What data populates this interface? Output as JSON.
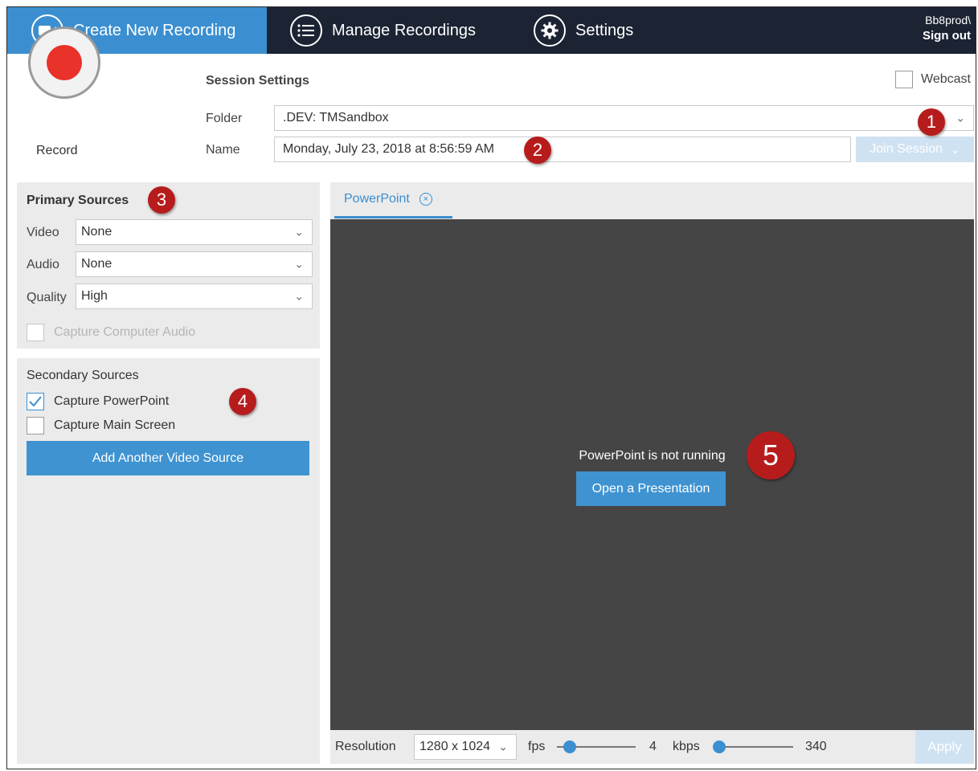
{
  "nav": {
    "tabs": [
      {
        "label": "Create New Recording",
        "icon": "video-camera-icon"
      },
      {
        "label": "Manage Recordings",
        "icon": "list-icon"
      },
      {
        "label": "Settings",
        "icon": "gear-icon"
      }
    ],
    "user": "Bb8prod\\",
    "sign_out": "Sign out"
  },
  "session": {
    "record_label": "Record",
    "title": "Session Settings",
    "webcast_label": "Webcast",
    "webcast_checked": false,
    "folder_label": "Folder",
    "folder_value": ".DEV: TMSandbox",
    "name_label": "Name",
    "name_value": "Monday, July 23, 2018 at 8:56:59 AM",
    "join_label": "Join Session"
  },
  "primary": {
    "title": "Primary Sources",
    "video_label": "Video",
    "video_value": "None",
    "audio_label": "Audio",
    "audio_value": "None",
    "quality_label": "Quality",
    "quality_value": "High",
    "capture_audio_label": "Capture Computer Audio"
  },
  "secondary": {
    "title": "Secondary Sources",
    "capture_pp_label": "Capture PowerPoint",
    "capture_pp_checked": true,
    "capture_main_label": "Capture Main Screen",
    "capture_main_checked": false,
    "add_video_label": "Add Another Video Source"
  },
  "preview": {
    "tab_label": "PowerPoint",
    "status": "PowerPoint is not running",
    "open_label": "Open a Presentation",
    "resolution_label": "Resolution",
    "resolution_value": "1280 x 1024",
    "fps_label": "fps",
    "fps_value": "4",
    "kbps_label": "kbps",
    "kbps_value": "340",
    "apply_label": "Apply"
  },
  "badges": [
    "1",
    "2",
    "3",
    "4",
    "5"
  ],
  "colors": {
    "nav_bg": "#1c2333",
    "accent": "#3b8fd0",
    "record_red": "#e8322a",
    "badge_red": "#b71c1c",
    "preview_bg": "#454545"
  }
}
